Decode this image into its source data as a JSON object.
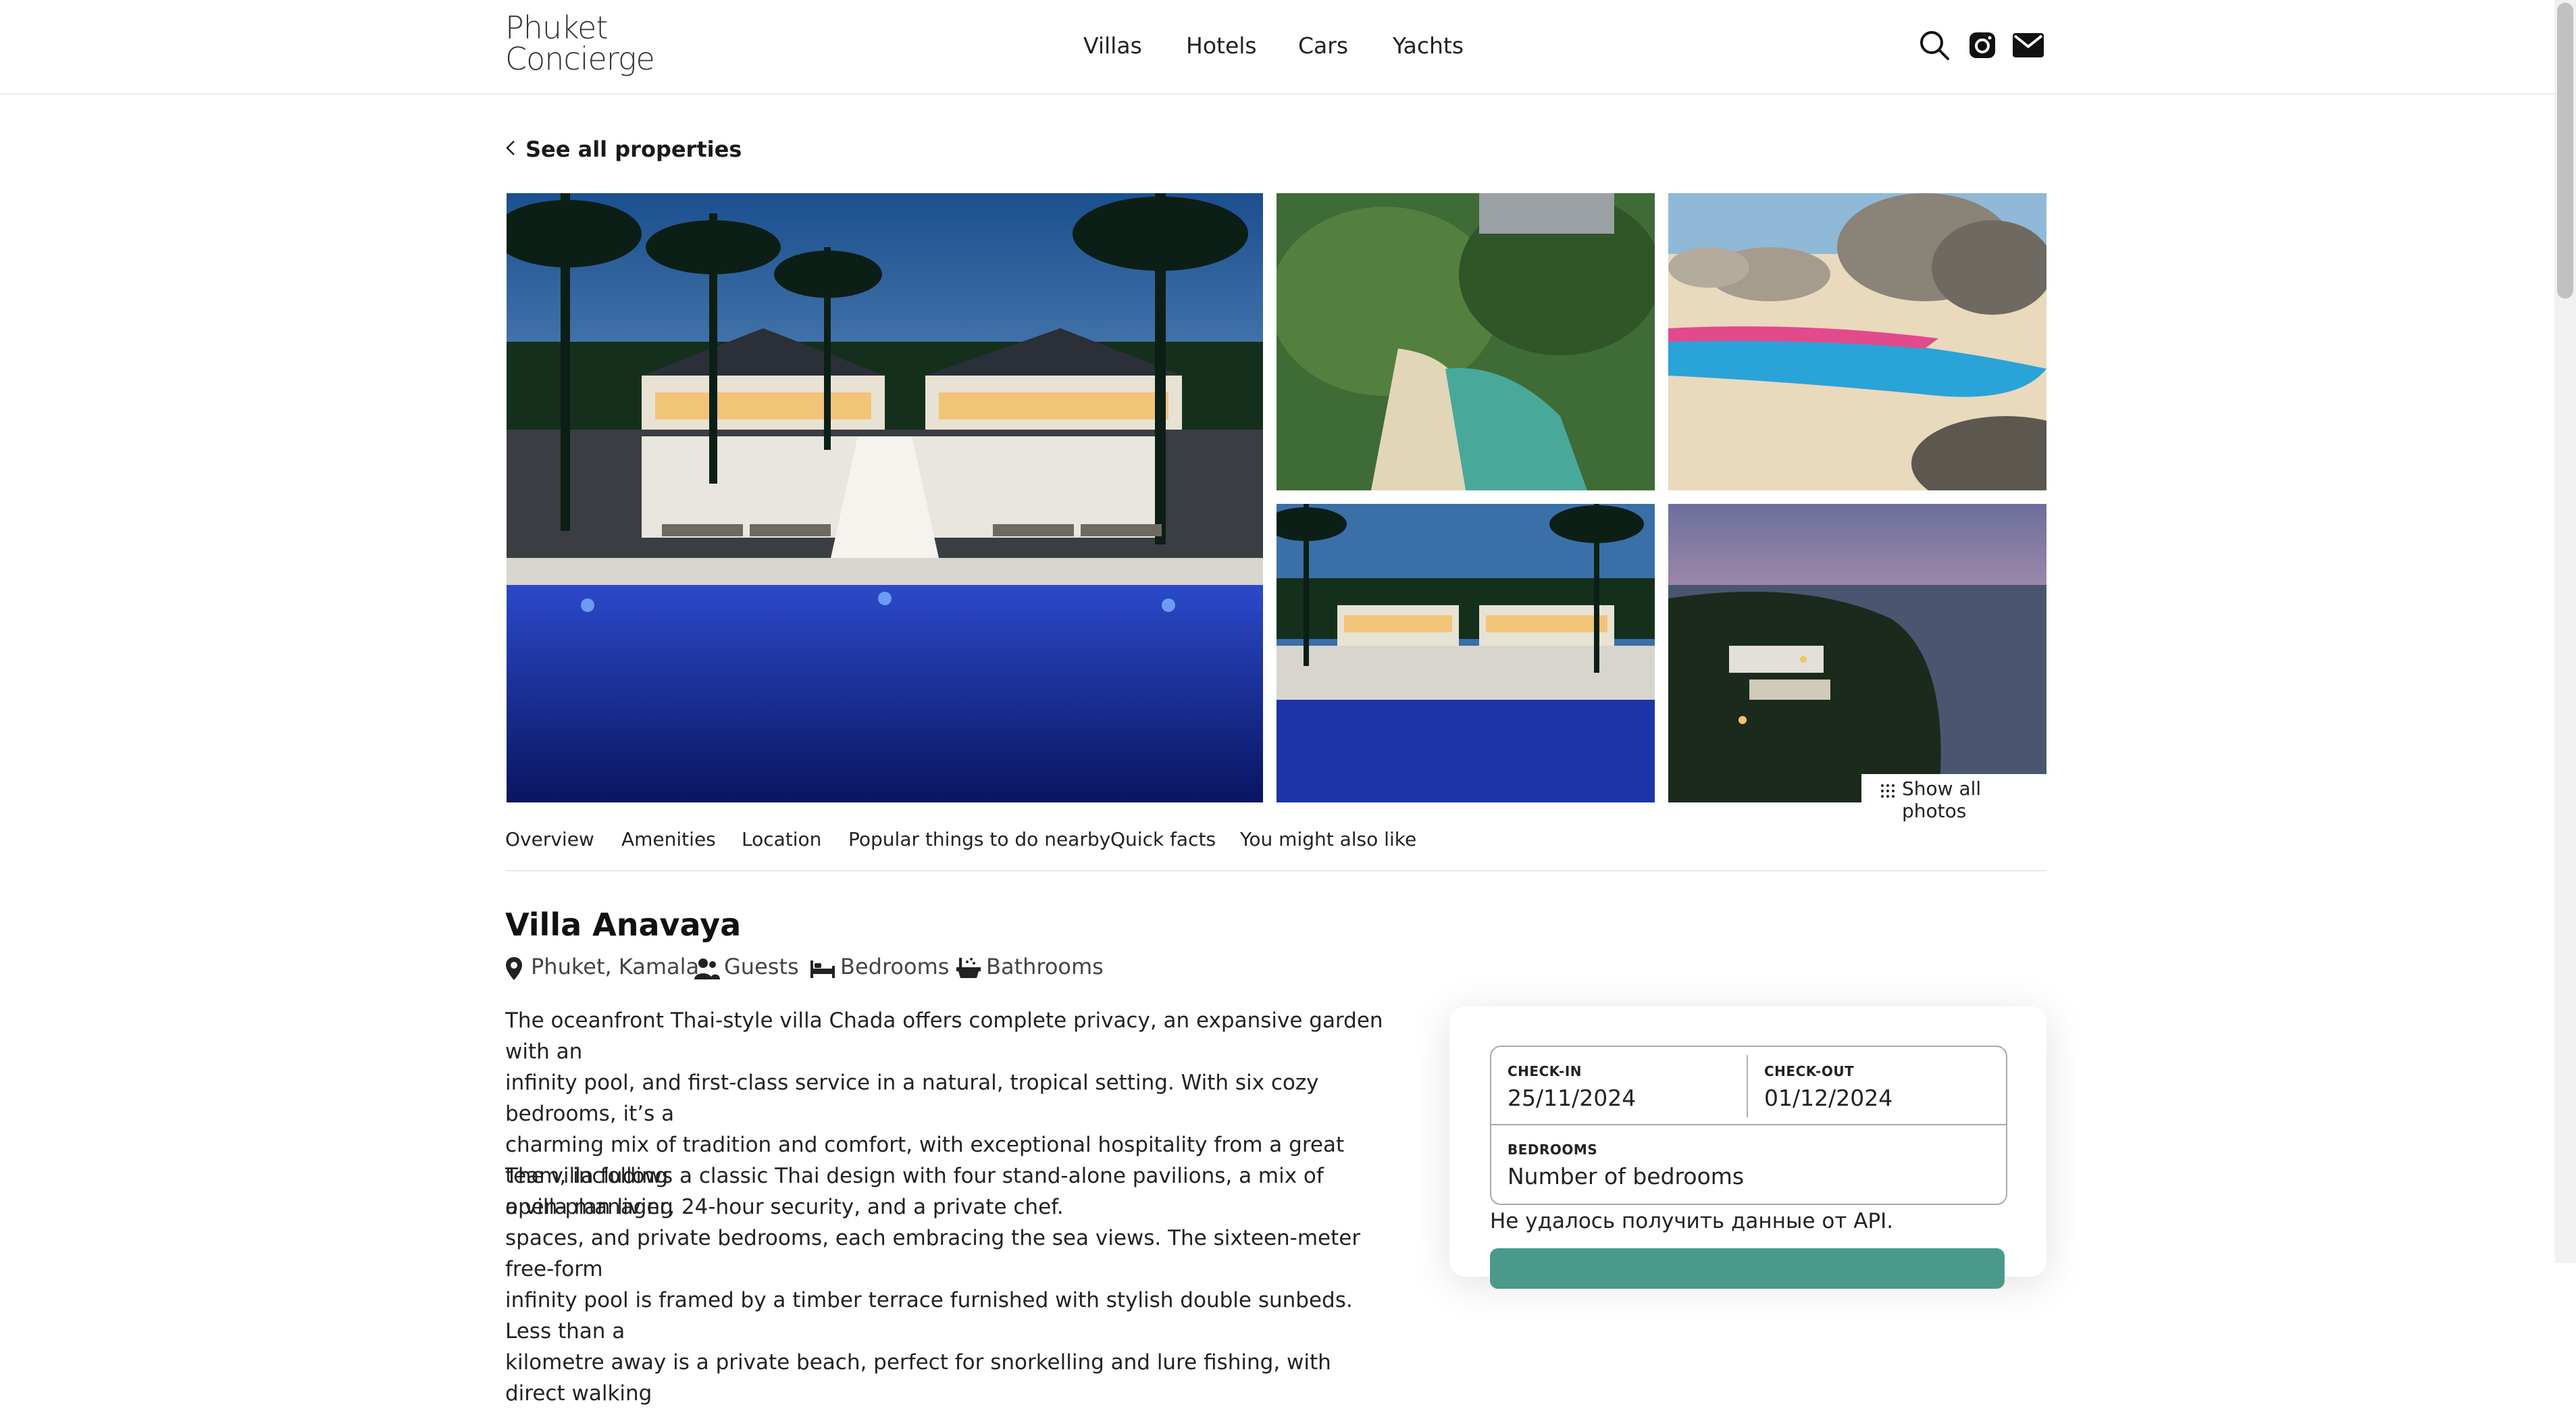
{
  "brand": {
    "line1": "Phuket",
    "line2": "Concierge"
  },
  "nav": {
    "villas": "Villas",
    "hotels": "Hotels",
    "cars": "Cars",
    "yachts": "Yachts"
  },
  "header_icons": [
    "search-icon",
    "instagram-icon",
    "mail-icon"
  ],
  "back_link": "See all properties",
  "gallery": {
    "show_all_label": "Show all photos",
    "photos": [
      "villa-pool-night",
      "aerial-coastline",
      "beach-kayaks",
      "villa-pool-night-small",
      "aerial-headland-sunset"
    ]
  },
  "tabs": [
    "Overview",
    "Amenities",
    "Location",
    "Popular things to do nearby",
    "Quick facts",
    "You might also like"
  ],
  "property": {
    "name": "Villa Anavaya",
    "location": "Phuket, Kamala",
    "guests_label": "Guests",
    "bedrooms_label": "Bedrooms",
    "bathrooms_label": "Bathrooms",
    "description_p1": [
      "The oceanfront Thai-style villa Chada offers complete privacy, an expansive garden with an",
      "infinity pool, and first-class service in a natural, tropical setting. With six cozy bedrooms, it’s a",
      "charming mix of tradition and comfort, with exceptional hospitality from a great team, including",
      "a villa manager, 24-hour security, and a private chef."
    ],
    "description_p2": [
      "The villa follows a classic Thai design with four stand-alone pavilions, a mix of open-plan living",
      "spaces, and private bedrooms, each embracing the sea views. The sixteen-meter free-form",
      "infinity pool is framed by a timber terrace furnished with stylish double sunbeds. Less than a",
      "kilometre away is a private beach, perfect for snorkelling and lure fishing, with direct walking"
    ]
  },
  "booking": {
    "checkin_label": "CHECK-IN",
    "checkin_value": "25/11/2024",
    "checkout_label": "CHECK-OUT",
    "checkout_value": "01/12/2024",
    "bedrooms_label": "BEDROOMS",
    "bedrooms_placeholder": "Number of bedrooms",
    "error_text": "Не удалось получить данные от API."
  },
  "colors": {
    "accent": "#4a9a8c",
    "text": "#1a1a1a"
  }
}
